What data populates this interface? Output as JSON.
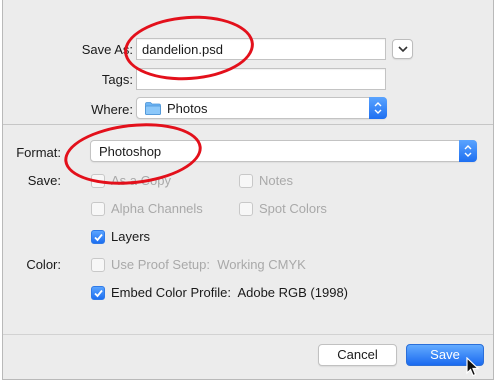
{
  "save_as": {
    "label": "Save As:",
    "value": "dandelion.psd"
  },
  "tags": {
    "label": "Tags:",
    "value": ""
  },
  "where": {
    "label": "Where:",
    "value": "Photos"
  },
  "format": {
    "label": "Format:",
    "value": "Photoshop"
  },
  "save_options": {
    "label": "Save:",
    "as_a_copy": {
      "label": "As a Copy",
      "checked": false,
      "enabled": false
    },
    "notes": {
      "label": "Notes",
      "checked": false,
      "enabled": false
    },
    "alpha_channels": {
      "label": "Alpha Channels",
      "checked": false,
      "enabled": false
    },
    "spot_colors": {
      "label": "Spot Colors",
      "checked": false,
      "enabled": false
    },
    "layers": {
      "label": "Layers",
      "checked": true,
      "enabled": true
    }
  },
  "color": {
    "label": "Color:",
    "use_proof_setup": {
      "label": "Use Proof Setup:  Working CMYK",
      "checked": false,
      "enabled": false
    },
    "embed_color_profile": {
      "label": "Embed Color Profile:  Adobe RGB (1998)",
      "checked": true,
      "enabled": true
    }
  },
  "buttons": {
    "cancel": "Cancel",
    "save": "Save"
  },
  "colors": {
    "accent": "#1e6ff1",
    "highlight_ellipse": "#e3101b",
    "panel": "#ececec"
  },
  "icons": {
    "where_popup": "folder-icon",
    "disclosure": "chevron-down-icon",
    "popup_stepper": "up-down-arrows-icon",
    "cursor": "pointer-cursor-icon"
  }
}
